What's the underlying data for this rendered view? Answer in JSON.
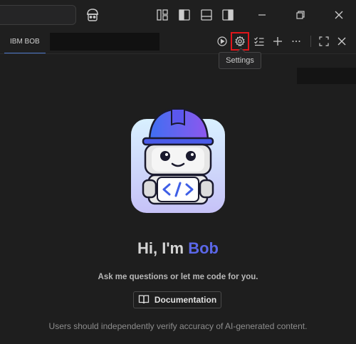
{
  "titlebar": {
    "icons": [
      "search-box",
      "bob-robot-icon",
      "customize-layout-icon",
      "toggle-primary-sidebar-icon",
      "toggle-panel-icon",
      "toggle-secondary-sidebar-icon",
      "minimize-icon",
      "restore-icon",
      "close-icon"
    ]
  },
  "tab": {
    "label": "IBM BOB"
  },
  "actions": {
    "icons": [
      "run-icon",
      "settings-icon",
      "checklist-icon",
      "plus-icon",
      "more-icon",
      "fullscreen-icon",
      "close-panel-icon"
    ]
  },
  "tooltip": {
    "text": "Settings"
  },
  "main": {
    "greeting_prefix": "Hi, I'm ",
    "greeting_name": "Bob",
    "subtitle": "Ask me questions or let me code for you.",
    "doc_button": "Documentation",
    "disclaimer": "Users should independently verify accuracy of AI-generated content."
  },
  "colors": {
    "accent": "#5b67e8",
    "highlight": "#e0161b",
    "background": "#1e1e1e"
  }
}
